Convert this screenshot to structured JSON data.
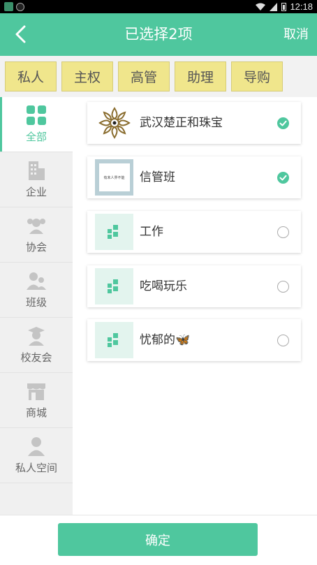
{
  "statusbar": {
    "time": "12:18"
  },
  "header": {
    "back_icon": "chevron-left-icon",
    "title": "已选择2项",
    "cancel_label": "取消"
  },
  "tags": [
    "私人",
    "主权",
    "高管",
    "助理",
    "导购"
  ],
  "sidebar": {
    "items": [
      {
        "label": "全部",
        "icon": "grid-icon",
        "active": true
      },
      {
        "label": "企业",
        "icon": "building-icon",
        "active": false
      },
      {
        "label": "协会",
        "icon": "group-icon",
        "active": false
      },
      {
        "label": "班级",
        "icon": "people-icon",
        "active": false
      },
      {
        "label": "校友会",
        "icon": "graduate-icon",
        "active": false
      },
      {
        "label": "商城",
        "icon": "store-icon",
        "active": false
      },
      {
        "label": "私人空间",
        "icon": "person-icon",
        "active": false
      }
    ]
  },
  "list": {
    "items": [
      {
        "name": "武汉楚正和珠宝",
        "checked": true,
        "thumb": "logo-ornament"
      },
      {
        "name": "信管班",
        "checked": true,
        "thumb": "book-cover",
        "thumb_text": "有未人界不能"
      },
      {
        "name": "工作",
        "checked": false,
        "thumb": "default-grid"
      },
      {
        "name": "吃喝玩乐",
        "checked": false,
        "thumb": "default-grid"
      },
      {
        "name": "忧郁的🦋",
        "checked": false,
        "thumb": "default-grid"
      }
    ]
  },
  "footer": {
    "confirm_label": "确定"
  },
  "colors": {
    "accent": "#4fc79e",
    "tag_bg": "#f0e68c",
    "sidebar_bg": "#f0f0f0"
  }
}
